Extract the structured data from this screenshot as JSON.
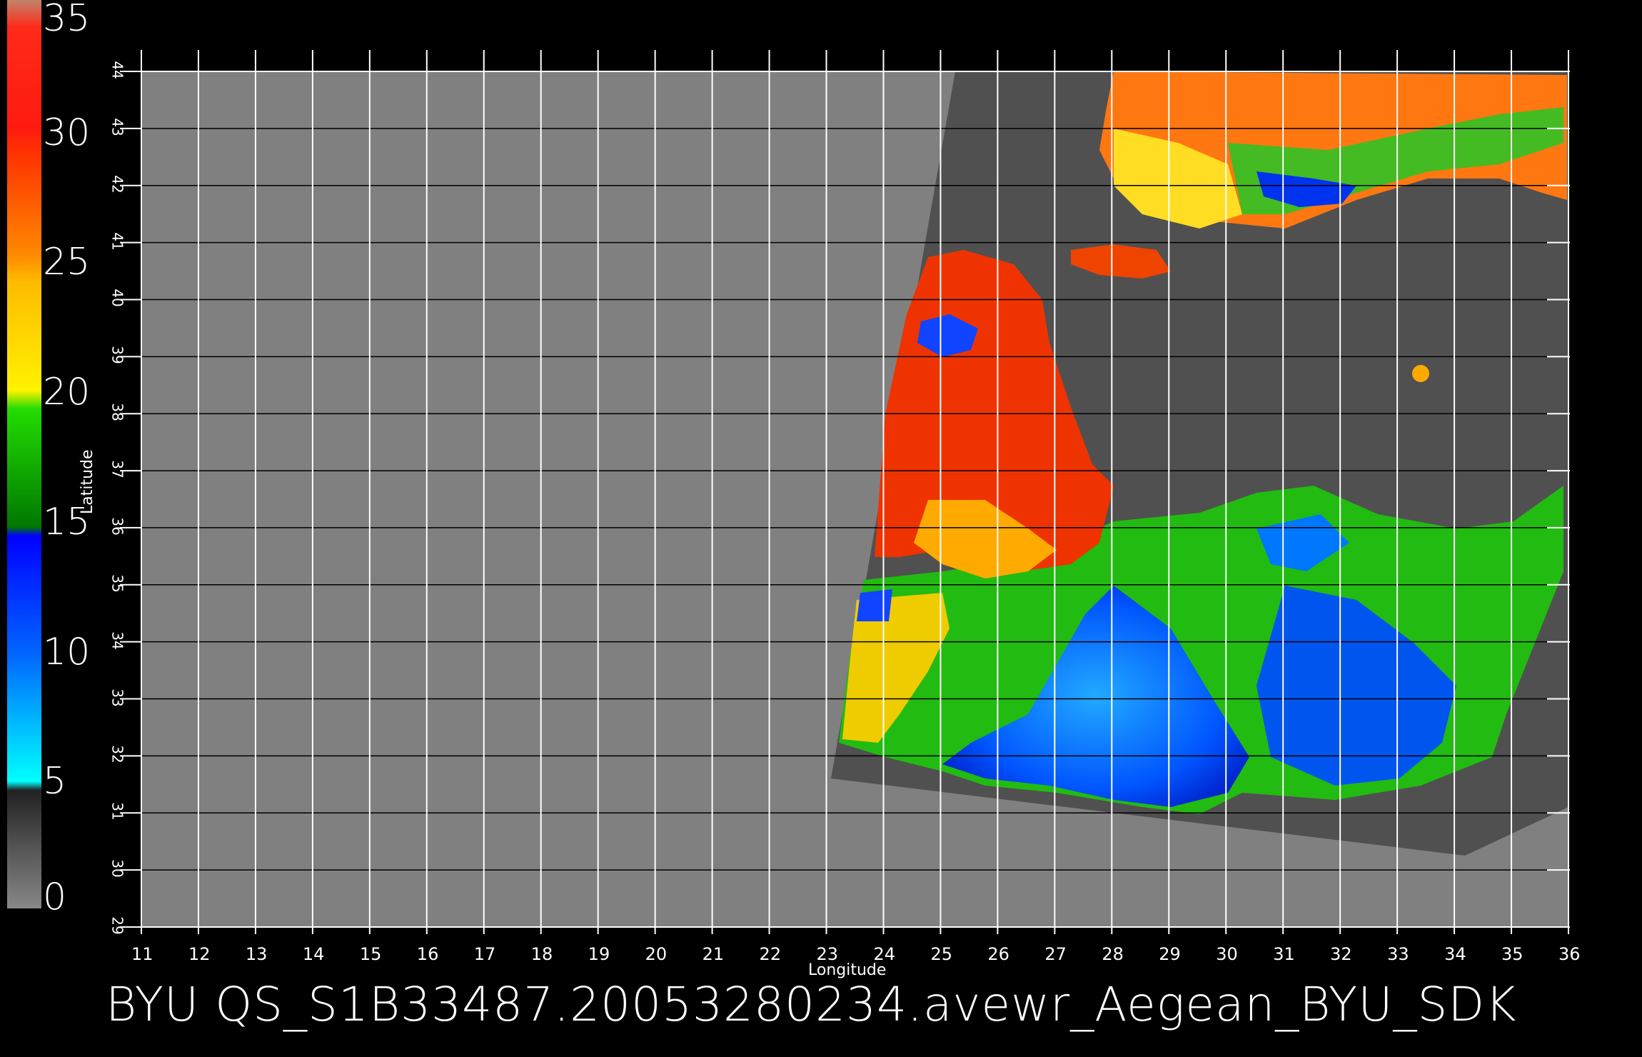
{
  "title": "BYU  QS_S1B33487.20053280234.avewr_Aegean_BYU_SDK",
  "x_axis": {
    "label": "Longitude",
    "ticks": [
      "11",
      "12",
      "13",
      "14",
      "15",
      "16",
      "17",
      "18",
      "19",
      "20",
      "21",
      "22",
      "23",
      "24",
      "25",
      "26",
      "27",
      "28",
      "29",
      "30",
      "31",
      "32",
      "33",
      "34",
      "35",
      "36"
    ]
  },
  "y_axis": {
    "label": "Latitude",
    "ticks": [
      "29",
      "30",
      "31",
      "32",
      "33",
      "34",
      "35",
      "36",
      "37",
      "38",
      "39",
      "40",
      "41",
      "42",
      "43",
      "44"
    ]
  },
  "colorbar": {
    "labels": [
      "35",
      "30",
      "25",
      "20",
      "15",
      "10",
      "5",
      "0"
    ],
    "values": [
      35,
      30,
      25,
      20,
      15,
      10,
      5,
      0
    ]
  },
  "colors": {
    "background": "#000000",
    "grid": "#000000",
    "land_gray": "#808080",
    "swath_no_data": "#505050",
    "cb_brown": "#c0846a",
    "cb_red": "#ff0000",
    "cb_orange": "#ff8800",
    "cb_yellow": "#ffee00",
    "cb_green": "#00bb00",
    "cb_blue": "#0044ff",
    "cb_cyan": "#00eeff",
    "cb_gray": "#555555"
  }
}
